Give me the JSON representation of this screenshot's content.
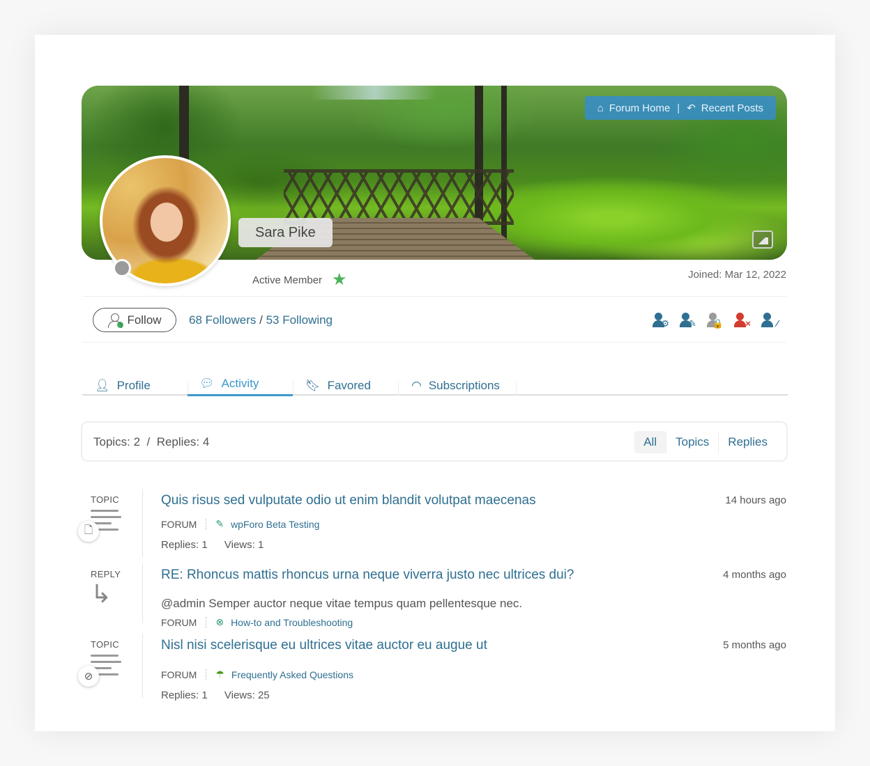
{
  "nav": {
    "forum_home": "Forum Home",
    "separator": "|",
    "recent_posts": "Recent Posts"
  },
  "profile": {
    "name": "Sara Pike",
    "rank": "Active Member",
    "joined": "Joined: Mar 12, 2022",
    "follow_label": "Follow",
    "followers": "68 Followers",
    "following": "53 Following"
  },
  "colors": {
    "link": "#2f6f91",
    "accent": "#3c97cc",
    "rank_star": "#4cb25a",
    "danger": "#d33b2c",
    "nav_bg": "#348cd2"
  },
  "actions": [
    {
      "name": "user-settings-icon",
      "color": "#2f6f91",
      "mark": "⚙"
    },
    {
      "name": "user-edit-icon",
      "color": "#2f6f91",
      "mark": "✎"
    },
    {
      "name": "user-lock-icon",
      "color": "#9a9a9a",
      "mark": "🔒"
    },
    {
      "name": "user-ban-icon",
      "color": "#d33b2c",
      "mark": "×"
    },
    {
      "name": "user-slash-icon",
      "color": "#2f6f91",
      "mark": "⁄"
    }
  ],
  "tabs": [
    {
      "label": "Profile",
      "icon": "user-icon"
    },
    {
      "label": "Activity",
      "icon": "comments-icon"
    },
    {
      "label": "Favored",
      "icon": "bookmark-icon"
    },
    {
      "label": "Subscriptions",
      "icon": "rss-icon"
    }
  ],
  "activity": {
    "totals": "Topics: 2  /  Replies: 4",
    "filters": [
      "All",
      "Topics",
      "Replies"
    ],
    "items": [
      {
        "type": "TOPIC",
        "title": "Quis risus sed vulputate odio ut enim blandit volutpat maecenas",
        "when": "14 hours ago",
        "forum_label": "FORUM",
        "forum": "wpForo Beta Testing",
        "replies": "Replies: 1",
        "views": "Views: 1"
      },
      {
        "type": "REPLY",
        "title": "RE: Rhoncus mattis rhoncus urna neque viverra justo nec ultrices dui?",
        "when": "4 months ago",
        "excerpt": "@admin Semper auctor neque vitae tempus quam pellentesque nec.",
        "forum_label": "FORUM",
        "forum": "How-to and Troubleshooting"
      },
      {
        "type": "TOPIC",
        "title": "Nisl nisi scelerisque eu ultrices vitae auctor eu augue ut",
        "when": "5 months ago",
        "forum_label": "FORUM",
        "forum": "Frequently Asked Questions",
        "replies": "Replies: 1",
        "views": "Views: 25"
      }
    ]
  }
}
